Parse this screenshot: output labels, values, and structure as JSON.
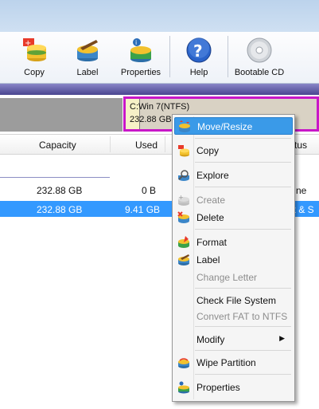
{
  "toolbar": {
    "buttons": [
      {
        "label": "Copy",
        "icon": "copy-disk-icon"
      },
      {
        "label": "Label",
        "icon": "label-icon"
      },
      {
        "label": "Properties",
        "icon": "properties-icon"
      },
      {
        "label": "Help",
        "icon": "help-icon"
      },
      {
        "label": "Bootable CD",
        "icon": "cd-icon"
      }
    ]
  },
  "disk_map": {
    "partition_name": "C:Win 7(NTFS)",
    "partition_size": "232.88 GB",
    "highlight_color": "#c817c8"
  },
  "table": {
    "columns": {
      "capacity": "Capacity",
      "used": "Used",
      "status": "tus"
    },
    "rows": [
      {
        "capacity": "232.88 GB",
        "used": "0 B",
        "status": "ne"
      },
      {
        "capacity": "232.88 GB",
        "used": "9.41 GB",
        "status": "ot & S"
      }
    ]
  },
  "context_menu": {
    "items": {
      "move_resize": "Move/Resize",
      "copy": "Copy",
      "explore": "Explore",
      "create": "Create",
      "delete": "Delete",
      "format": "Format",
      "label": "Label",
      "change_letter": "Change Letter",
      "check_fs": "Check File System",
      "convert": "Convert FAT to NTFS",
      "modify": "Modify",
      "wipe": "Wipe Partition",
      "properties": "Properties"
    }
  },
  "colors": {
    "selection": "#3399ff",
    "menu_highlight": "#3a9ae8"
  }
}
